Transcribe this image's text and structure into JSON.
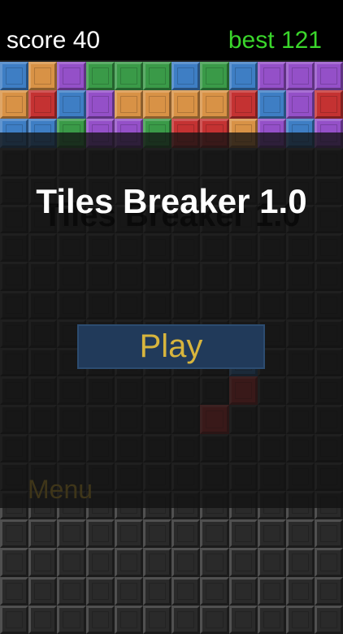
{
  "hud": {
    "score_label": "score",
    "score_value": "40",
    "best_label": "best",
    "best_value": "121"
  },
  "title": "Tiles Breaker 1.0",
  "play_label": "Play",
  "menu_label": "Menu",
  "colors": {
    "blue": "#3e7ec4",
    "orange": "#d89246",
    "purple": "#9450c8",
    "green": "#3a9a48",
    "red": "#c43232",
    "pink": "#b057c0",
    "lightblue": "#4b8ed0",
    "empty": "#2a2a2a",
    "best_green": "#3ad62b",
    "play_text": "#d8b53d",
    "play_bg": "#213a5a"
  },
  "board": {
    "rows": [
      [
        "blue",
        "orange",
        "purple",
        "green",
        "green",
        "green",
        "blue",
        "green",
        "blue",
        "purple",
        "purple",
        "purple"
      ],
      [
        "orange",
        "red",
        "blue",
        "purple",
        "orange",
        "orange",
        "orange",
        "orange",
        "red",
        "blue",
        "purple",
        "red"
      ],
      [
        "blue",
        "blue",
        "green",
        "purple",
        "purple",
        "green",
        "red",
        "red",
        "orange",
        "purple",
        "blue",
        "purple"
      ]
    ]
  }
}
